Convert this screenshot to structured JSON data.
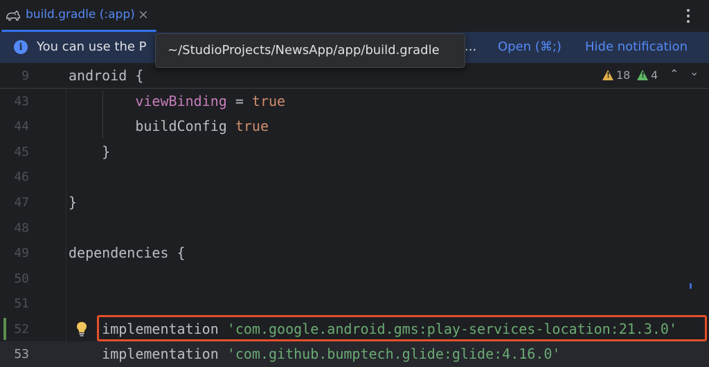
{
  "tab": {
    "label": "build.gradle (:app)",
    "close": "×"
  },
  "notification": {
    "text": "You can use the P",
    "ellipsis": "...",
    "open_link": "Open (⌘;)",
    "hide_link": "Hide notification"
  },
  "tooltip": {
    "path": "~/StudioProjects/NewsApp/app/build.gradle"
  },
  "sticky_header": {
    "line_number": "9",
    "code": "android {"
  },
  "inspections": {
    "warnings": "18",
    "weak_warnings": "4"
  },
  "lines": [
    {
      "num": "43",
      "indent": "        ",
      "prop": "viewBinding",
      "op": " = ",
      "kw": "true"
    },
    {
      "num": "44",
      "indent": "        ",
      "text": "buildConfig ",
      "kw": "true"
    },
    {
      "num": "45",
      "text": "    }"
    },
    {
      "num": "46",
      "text": ""
    },
    {
      "num": "47",
      "text": "}"
    },
    {
      "num": "48",
      "text": ""
    },
    {
      "num": "49",
      "text": "dependencies {"
    },
    {
      "num": "50",
      "text": ""
    },
    {
      "num": "51",
      "text": ""
    },
    {
      "num": "52",
      "indent": "    ",
      "text": "implementation ",
      "str": "'com.google.android.gms:play-services-location:21.3.0'"
    },
    {
      "num": "53",
      "indent": "    ",
      "text": "implementation ",
      "str": "'com.github.bumptech.glide:glide:4.16.0'"
    }
  ],
  "colors": {
    "accent": "#548af7",
    "keyword": "#cf8e6d",
    "property": "#c77dbb",
    "string": "#6aab73",
    "highlight_box": "#e5502a"
  }
}
